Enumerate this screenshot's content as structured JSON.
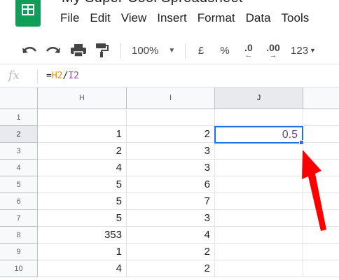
{
  "app": {
    "title": "My Super Cool Spreadsheet",
    "logo_icon": "sheets-logo-icon"
  },
  "menu": [
    "File",
    "Edit",
    "View",
    "Insert",
    "Format",
    "Data",
    "Tools"
  ],
  "toolbar": {
    "undo_icon": "undo-icon",
    "redo_icon": "redo-icon",
    "print_icon": "print-icon",
    "paint_format_icon": "paint-format-icon",
    "zoom": "100%",
    "currency": "£",
    "percent": "%",
    "decrease_decimal": ".0",
    "increase_decimal": ".00",
    "more_formats": "123"
  },
  "formula_bar": {
    "fx_label": "fx",
    "prefix": "=",
    "ref1": "H2",
    "op": "/",
    "ref2": "I2"
  },
  "grid": {
    "columns": [
      "H",
      "I",
      "J"
    ],
    "rows": [
      {
        "num": "1",
        "h": "",
        "i": "",
        "j": ""
      },
      {
        "num": "2",
        "h": "1",
        "i": "2",
        "j": "0.5"
      },
      {
        "num": "3",
        "h": "2",
        "i": "3",
        "j": ""
      },
      {
        "num": "4",
        "h": "4",
        "i": "3",
        "j": ""
      },
      {
        "num": "5",
        "h": "5",
        "i": "6",
        "j": ""
      },
      {
        "num": "6",
        "h": "5",
        "i": "7",
        "j": ""
      },
      {
        "num": "7",
        "h": "5",
        "i": "3",
        "j": ""
      },
      {
        "num": "8",
        "h": "353",
        "i": "4",
        "j": ""
      },
      {
        "num": "9",
        "h": "1",
        "i": "2",
        "j": ""
      },
      {
        "num": "10",
        "h": "4",
        "i": "2",
        "j": ""
      }
    ],
    "active_cell": "J2"
  },
  "colors": {
    "brand": "#0f9d58",
    "selection": "#1a73e8",
    "annotation_arrow": "#ff0000",
    "ref_h": "#e69100",
    "ref_i": "#a33eb3"
  }
}
